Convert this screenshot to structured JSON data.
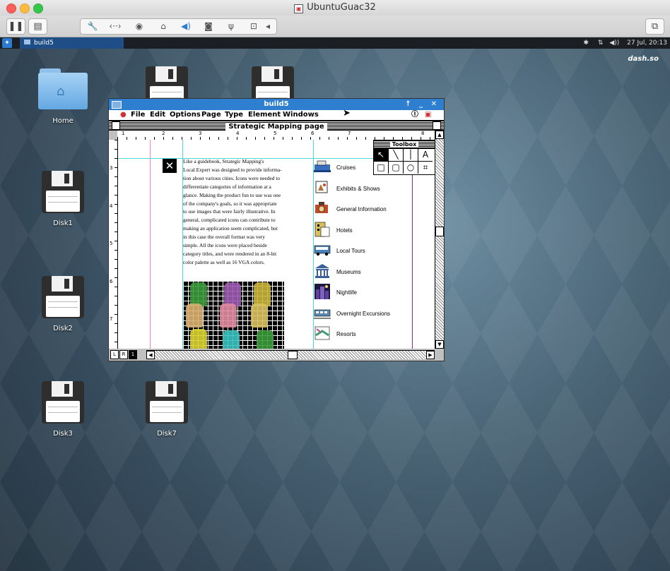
{
  "host_window": {
    "title": "UbuntuGuac32",
    "colors": {
      "close": "#fc605c",
      "minimize": "#fdbc40",
      "zoom": "#34c84a"
    }
  },
  "toolbar": {
    "pause_icon": "pause-icon",
    "display_icon": "display-icon",
    "tools": [
      "wrench-icon",
      "arrows-icon",
      "cd-icon",
      "hdd-icon",
      "volume-icon",
      "camera-icon",
      "usb-icon",
      "shared-folder-icon",
      "chevron-left-icon"
    ],
    "right_icon": "window-icon"
  },
  "panel": {
    "task_label": "build5",
    "tray": {
      "bluetooth": "bluetooth-icon",
      "network": "network-icon",
      "volume": "volume-icon",
      "datetime": "27 Jul, 20:13"
    },
    "brand": "dash.so"
  },
  "desktop_icons": [
    {
      "label": "Home",
      "type": "folder"
    },
    {
      "label": "",
      "type": "floppy"
    },
    {
      "label": "",
      "type": "floppy"
    },
    {
      "label": "Disk1",
      "type": "floppy"
    },
    {
      "label": "Disk2",
      "type": "floppy"
    },
    {
      "label": "Disk3",
      "type": "floppy"
    },
    {
      "label": "Disk7",
      "type": "floppy"
    }
  ],
  "app_window": {
    "title": "build5",
    "controls": "↑ _ ✕",
    "menus": [
      "File",
      "Edit",
      "Options",
      "Page",
      "Type",
      "Element",
      "Windows"
    ],
    "document_title": "Strategic Mapping page",
    "ruler_numbers": [
      "1",
      "2",
      "3",
      "4",
      "5",
      "6",
      "7",
      "8"
    ],
    "vruler_numbers": [
      "3",
      "4",
      "5",
      "6",
      "7"
    ],
    "page_tabs": [
      "L",
      "R",
      "1"
    ]
  },
  "body_text": [
    "Like a guidebook, Strategic Mapping's",
    "Local Expert was designed to provide informa-",
    "tion about various cities. Icons were needed to",
    "differentiate categories of information at a",
    "glance. Making the product fun to use was one",
    "of the company's goals, so it was appropriate",
    "to use images that were fairly illustrative. In",
    "general, complicated icons can contribute to",
    "making an application seem complicated, but",
    "in this case the overall format was very",
    "simple. All the icons were placed beside",
    "category titles, and were rendered in an 8-bit",
    "color palette as well as 16 VGA colors."
  ],
  "categories": [
    {
      "label": "Cruises",
      "icon": "cruise-ship-icon",
      "color": "#3a6fc0"
    },
    {
      "label": "Exhibits & Shows",
      "icon": "exhibit-icon",
      "color": "#b0703a"
    },
    {
      "label": "General Information",
      "icon": "info-icon",
      "color": "#c04a2a"
    },
    {
      "label": "Hotels",
      "icon": "hotel-icon",
      "color": "#d8c060"
    },
    {
      "label": "Local Tours",
      "icon": "tour-bus-icon",
      "color": "#4a7fb8"
    },
    {
      "label": "Museums",
      "icon": "museum-icon",
      "color": "#3a5f9a"
    },
    {
      "label": "Nightlife",
      "icon": "nightlife-icon",
      "color": "#6040a0"
    },
    {
      "label": "Overnight Excursions",
      "icon": "train-icon",
      "color": "#5a86b0"
    },
    {
      "label": "Resorts",
      "icon": "resort-icon",
      "color": "#3aa070"
    }
  ],
  "toolbox": {
    "title": "Toolbox",
    "tools": [
      "↖",
      "╲",
      "│",
      "A",
      "□",
      "▢",
      "○",
      "⌗"
    ]
  }
}
